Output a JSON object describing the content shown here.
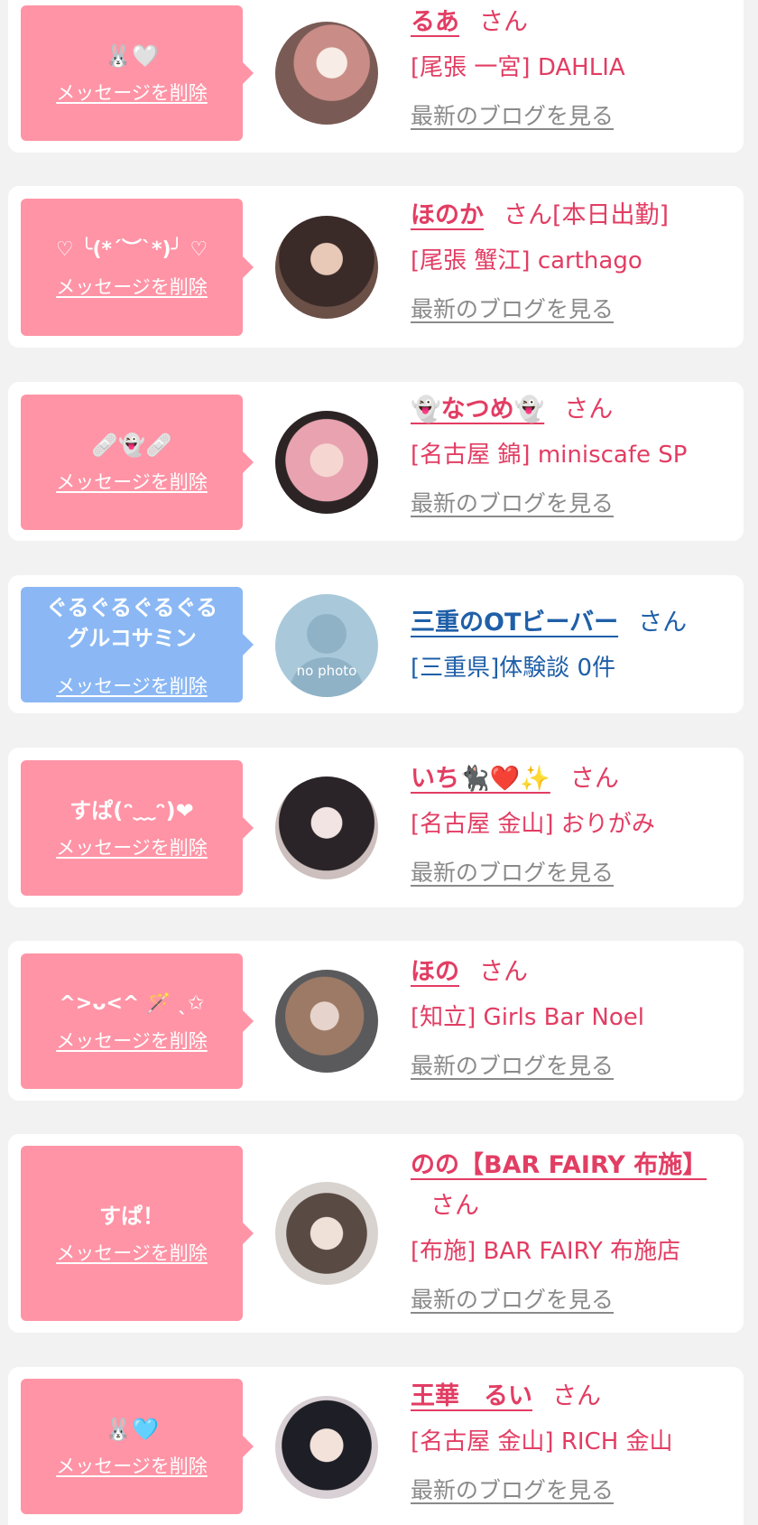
{
  "delete_label": "メッセージを削除",
  "san_label": "さん",
  "blog_label": "最新のブログを見る",
  "colors": {
    "pink_bubble": "#ff94a6",
    "blue_bubble": "#8bb8f4",
    "pink_text": "#e23d63",
    "blue_text": "#1f5fa8"
  },
  "entries": [
    {
      "message": "🐰🤍",
      "name": "るあ",
      "tag": "",
      "shop": "[尾張 一宮] DAHLIA",
      "theme": "pink"
    },
    {
      "message": "♡ ╰(*´︶`*)╯ ♡",
      "name": "ほのか",
      "tag": "[本日出勤]",
      "shop": "[尾張 蟹江] carthago",
      "theme": "pink"
    },
    {
      "message": "🩹👻🩹",
      "name": "👻なつめ👻",
      "tag": "",
      "shop": "[名古屋 錦] miniscafe SP",
      "theme": "pink"
    },
    {
      "message": "ぐるぐるぐるぐる\nグルコサミン",
      "name": "三重のOTビーバー",
      "tag": "",
      "shop": "[三重県]体験談 0件",
      "theme": "blue",
      "avatar_text": "no photo"
    },
    {
      "message": "すぱ(ᵔ﹏ᵔ)❤",
      "name": "いち🐈‍⬛❤️✨",
      "tag": "",
      "shop": "[名古屋 金山] おりがみ",
      "theme": "pink"
    },
    {
      "message": "^>ᴗ<^ 🪄 ˎ✩",
      "name": "ほの",
      "tag": "",
      "shop": "[知立] Girls Bar Noel",
      "theme": "pink"
    },
    {
      "message": "すぱ！",
      "name": "のの【BAR FAIRY 布施】",
      "tag": "",
      "shop": "[布施] BAR FAIRY 布施店",
      "theme": "pink"
    },
    {
      "message": "🐰🩵",
      "name": "王華　るい",
      "tag": "",
      "shop": "[名古屋 金山] RICH 金山",
      "theme": "pink"
    }
  ]
}
